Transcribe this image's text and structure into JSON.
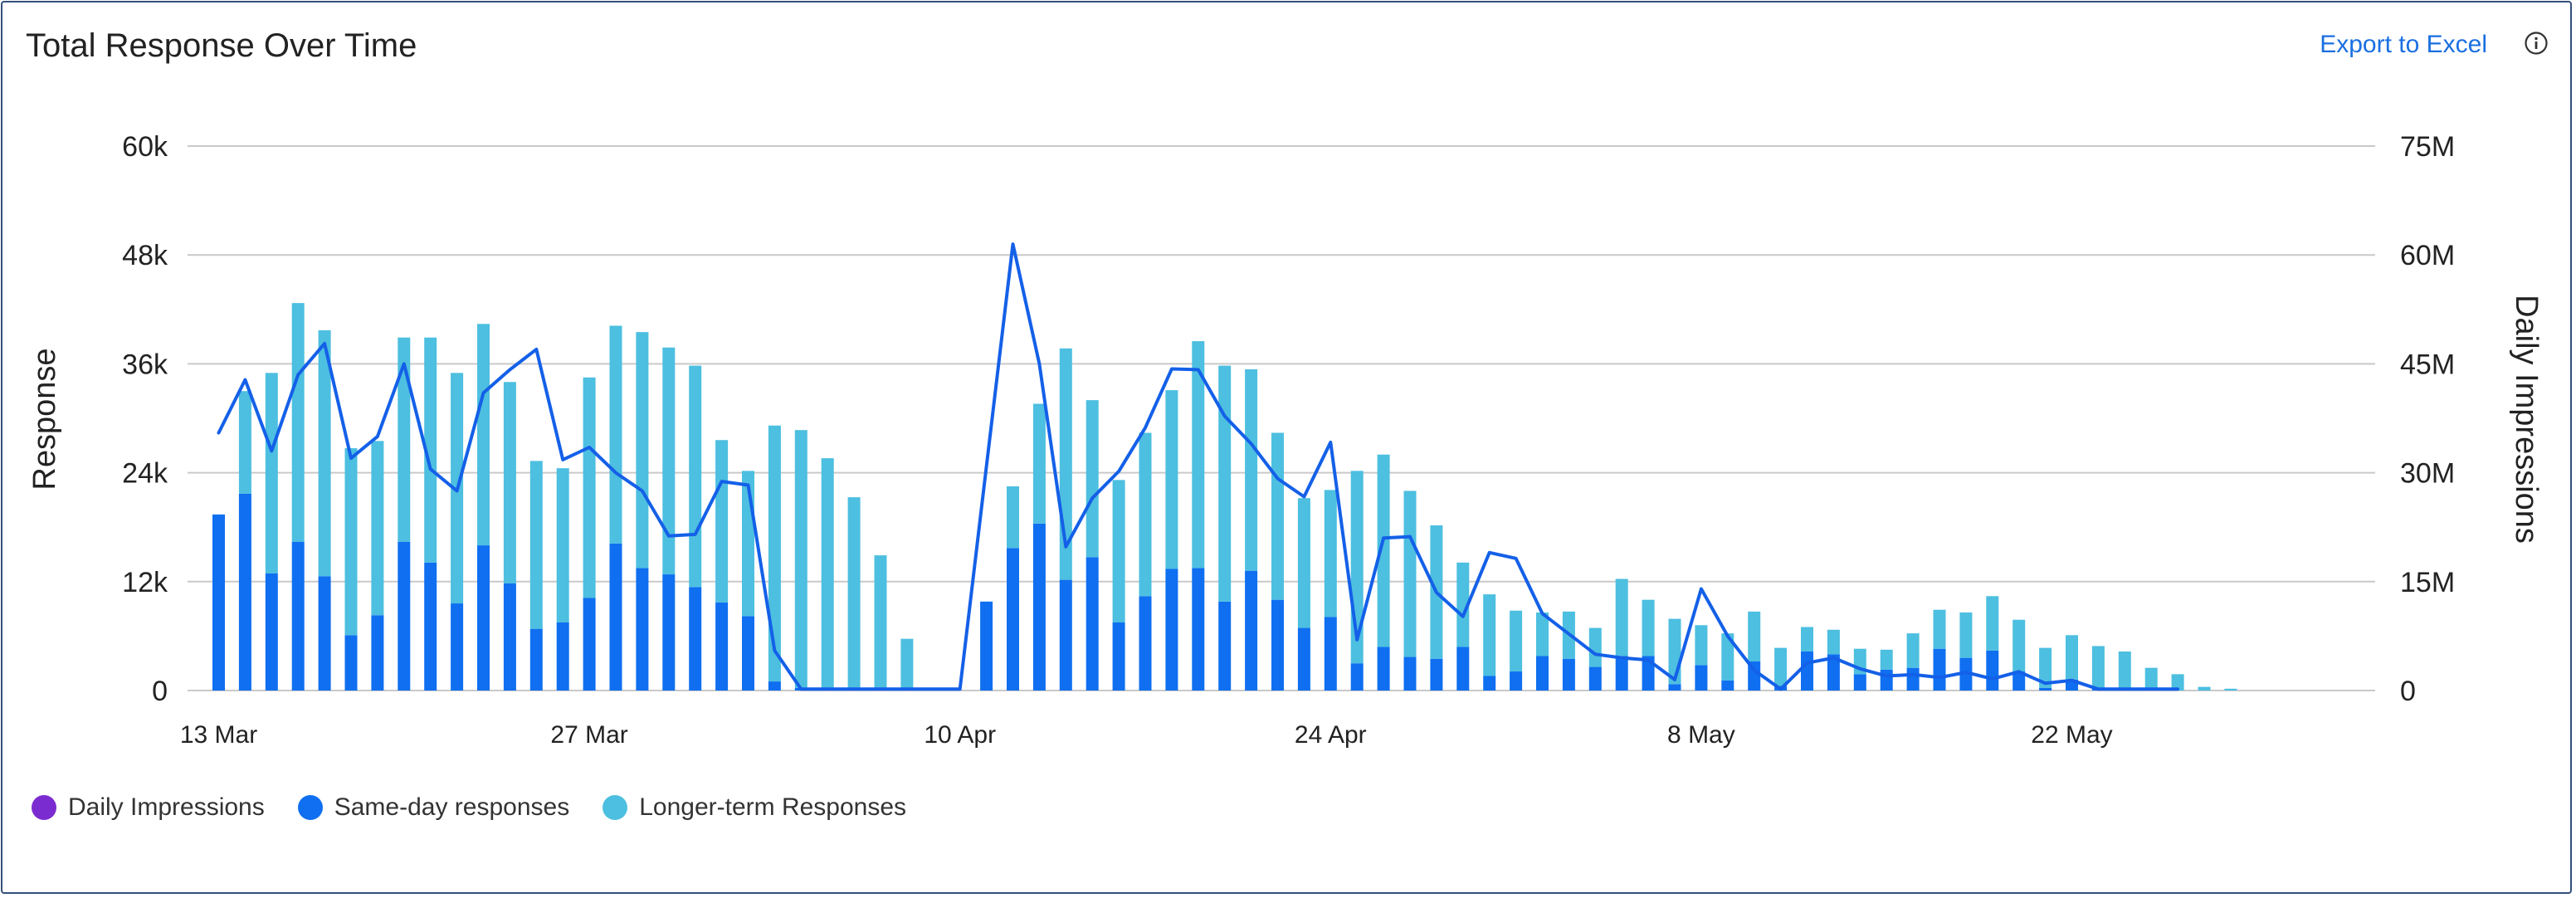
{
  "header": {
    "title": "Total Response Over Time",
    "export_label": "Export to Excel",
    "info_icon": "info-icon"
  },
  "colors": {
    "daily_impressions_legend": "#7b2cd0",
    "same_day": "#0f6ff0",
    "longer_term": "#4dbfe0",
    "impressions_line": "#1460e8",
    "grid": "#c9c9c9"
  },
  "chart_data": {
    "type": "bar",
    "title": "Total Response Over Time",
    "ylabel": "Response",
    "y2label": "Daily Impressions",
    "ylim": [
      0,
      60000
    ],
    "y2lim": [
      0,
      75000000
    ],
    "y_ticks": [
      "0",
      "12k",
      "24k",
      "36k",
      "48k",
      "60k"
    ],
    "y2_ticks": [
      "0",
      "15M",
      "30M",
      "45M",
      "60M",
      "75M"
    ],
    "x_ticks": [
      {
        "index": 0,
        "label": "13 Mar"
      },
      {
        "index": 14,
        "label": "27 Mar"
      },
      {
        "index": 28,
        "label": "10 Apr"
      },
      {
        "index": 42,
        "label": "24 Apr"
      },
      {
        "index": 56,
        "label": "8 May"
      },
      {
        "index": 70,
        "label": "22 May"
      }
    ],
    "grid": true,
    "legend_position": "bottom-left",
    "series": [
      {
        "name": "Same-day responses",
        "type": "bar-stacked",
        "values": [
          19400,
          21700,
          12900,
          16400,
          12600,
          6100,
          8300,
          16400,
          14100,
          9600,
          16000,
          11800,
          6800,
          7500,
          10200,
          16200,
          13500,
          12800,
          11400,
          9700,
          8200,
          1000,
          300,
          200,
          200,
          0,
          0,
          0,
          0,
          9800,
          15700,
          18400,
          12200,
          14700,
          7500,
          10400,
          13400,
          13500,
          9800,
          13200,
          10000,
          6900,
          8100,
          3000,
          4800,
          3700,
          3500,
          4800,
          1600,
          2100,
          3800,
          3500,
          2600,
          3800,
          3800,
          700,
          2800,
          1100,
          3200,
          500,
          4300,
          4000,
          1800,
          2300,
          2500,
          4600,
          3600,
          4400,
          2100,
          300,
          1200,
          300,
          300,
          0,
          0,
          0
        ]
      },
      {
        "name": "Longer-term Responses",
        "type": "bar-stacked",
        "values": [
          0,
          11300,
          22100,
          26300,
          27100,
          20600,
          19200,
          22500,
          24800,
          25400,
          24400,
          22200,
          18500,
          17000,
          24300,
          24000,
          26000,
          25000,
          24400,
          17900,
          16000,
          28200,
          28400,
          25400,
          21100,
          14900,
          5700,
          0,
          0,
          0,
          6800,
          13200,
          25500,
          17300,
          15700,
          18000,
          19700,
          25000,
          26000,
          22200,
          18400,
          14300,
          14000,
          21200,
          21200,
          18300,
          14700,
          9300,
          9000,
          6700,
          4800,
          5200,
          4300,
          8500,
          6200,
          7200,
          4400,
          5200,
          5500,
          4200,
          2700,
          2700,
          2800,
          2200,
          3800,
          4300,
          5000,
          6000,
          5700,
          4400,
          4900,
          4600,
          4000,
          2500,
          1800,
          400,
          200
        ]
      },
      {
        "name": "Daily Impressions",
        "type": "line",
        "axis": "right",
        "values": [
          35500000,
          42800000,
          33000000,
          43500000,
          47800000,
          32000000,
          35000000,
          45000000,
          30500000,
          27500000,
          41000000,
          44200000,
          47000000,
          31800000,
          33500000,
          30000000,
          27500000,
          21300000,
          21500000,
          28800000,
          28300000,
          5500000,
          200000,
          200000,
          200000,
          200000,
          200000,
          200000,
          200000,
          null,
          61500000,
          45000000,
          19800000,
          26500000,
          30200000,
          36200000,
          44300000,
          44200000,
          37800000,
          34000000,
          29200000,
          26700000,
          34200000,
          7000000,
          21000000,
          21200000,
          13500000,
          10200000,
          19000000,
          18200000,
          10600000,
          7800000,
          5000000,
          4500000,
          4200000,
          1500000,
          14000000,
          7500000,
          2800000,
          200000,
          3800000,
          4500000,
          3000000,
          2000000,
          2200000,
          1800000,
          2500000,
          1600000,
          2600000,
          1000000,
          1400000,
          200000,
          200000,
          200000,
          200000,
          null,
          null
        ]
      }
    ],
    "legend": [
      {
        "name": "Daily Impressions",
        "color": "#7b2cd0"
      },
      {
        "name": "Same-day responses",
        "color": "#0f6ff0"
      },
      {
        "name": "Longer-term Responses",
        "color": "#4dbfe0"
      }
    ]
  }
}
